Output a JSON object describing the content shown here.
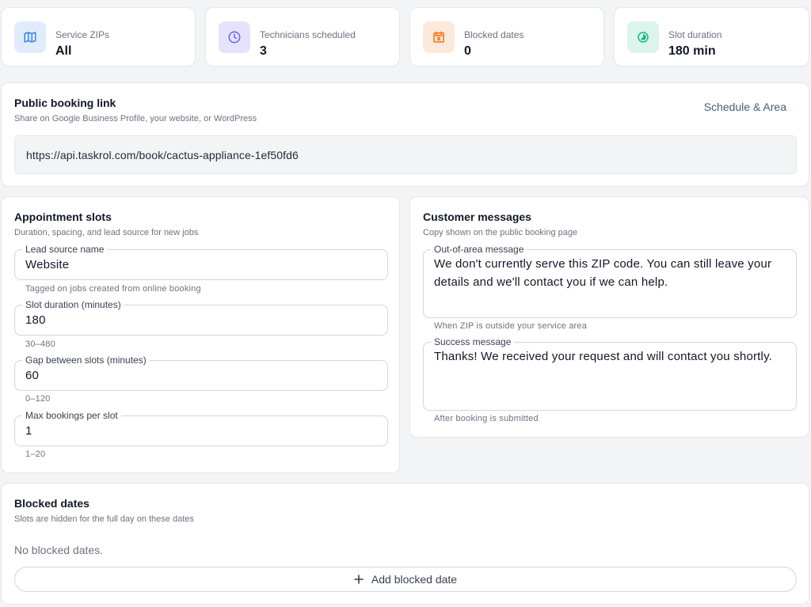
{
  "stats": [
    {
      "label": "Service ZIPs",
      "value": "All",
      "icon": "map-icon",
      "bg": "#e0ecfc",
      "fg": "#3b82f6"
    },
    {
      "label": "Technicians scheduled",
      "value": "3",
      "icon": "clock-icon",
      "bg": "#e5e3fb",
      "fg": "#6366f1"
    },
    {
      "label": "Blocked dates",
      "value": "0",
      "icon": "calendar-x-icon",
      "bg": "#fde8dc",
      "fg": "#f97316"
    },
    {
      "label": "Slot duration",
      "value": "180 min",
      "icon": "timer-icon",
      "bg": "#dcf5ea",
      "fg": "#10b981"
    }
  ],
  "booking_link": {
    "title": "Public booking link",
    "subtitle": "Share on Google Business Profile, your website, or WordPress",
    "action": "Schedule & Area",
    "url": "https://api.taskrol.com/book/cactus-appliance-1ef50fd6"
  },
  "slots": {
    "title": "Appointment slots",
    "subtitle": "Duration, spacing, and lead source for new jobs",
    "fields": [
      {
        "label": "Lead source name",
        "value": "Website",
        "helper": "Tagged on jobs created from online booking"
      },
      {
        "label": "Slot duration (minutes)",
        "value": "180",
        "helper": "30–480"
      },
      {
        "label": "Gap between slots (minutes)",
        "value": "60",
        "helper": "0–120"
      },
      {
        "label": "Max bookings per slot",
        "value": "1",
        "helper": "1–20"
      }
    ]
  },
  "messages": {
    "title": "Customer messages",
    "subtitle": "Copy shown on the public booking page",
    "fields": [
      {
        "label": "Out-of-area message",
        "value": "We don't currently serve this ZIP code. You can still leave your details and we'll contact you if we can help.",
        "helper": "When ZIP is outside your service area"
      },
      {
        "label": "Success message",
        "value": "Thanks! We received your request and will contact you shortly.",
        "helper": "After booking is submitted"
      }
    ]
  },
  "blocked": {
    "title": "Blocked dates",
    "subtitle": "Slots are hidden for the full day on these dates",
    "empty": "No blocked dates.",
    "add_label": "Add blocked date"
  }
}
